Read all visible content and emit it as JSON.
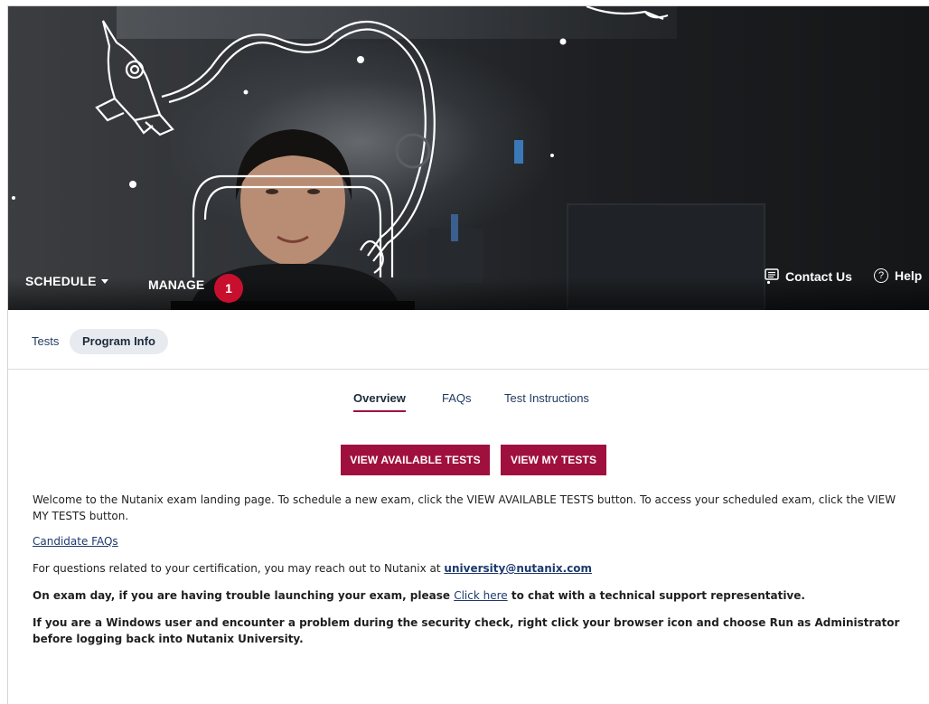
{
  "hero": {
    "nav": {
      "schedule_label": "SCHEDULE",
      "manage_label": "MANAGE",
      "manage_badge_count": "1"
    },
    "utility": {
      "contact_label": "Contact Us",
      "help_label": "Help",
      "help_glyph": "?"
    }
  },
  "subnav": {
    "tabs": [
      {
        "label": "Tests",
        "active": false
      },
      {
        "label": "Program Info",
        "active": true
      }
    ]
  },
  "content_tabs": [
    {
      "label": "Overview",
      "active": true
    },
    {
      "label": "FAQs",
      "active": false
    },
    {
      "label": "Test Instructions",
      "active": false
    }
  ],
  "actions": {
    "view_available_label": "VIEW AVAILABLE TESTS",
    "view_my_label": "VIEW MY TESTS"
  },
  "body": {
    "welcome": "Welcome to the Nutanix exam landing page. To schedule a new exam, click the VIEW AVAILABLE TESTS button. To access your scheduled exam, click the VIEW MY TESTS button.",
    "candidate_faqs_link": "Candidate FAQs",
    "questions_prefix": "For questions related to your certification, you may reach out to Nutanix at ",
    "questions_email": "university@nutanix.com",
    "examday_prefix": "On exam day, if you are having trouble launching your exam, please ",
    "examday_link": "Click here",
    "examday_suffix": " to chat with a technical support representative.",
    "windows_note": "If you are a Windows user and encounter a problem during the security check, right click your browser icon and choose Run as Administrator before logging back into Nutanix University."
  },
  "colors": {
    "accent": "#a0103f",
    "badge": "#c8102e",
    "link": "#1e3a6f",
    "pill_bg": "#e7ebf0"
  }
}
